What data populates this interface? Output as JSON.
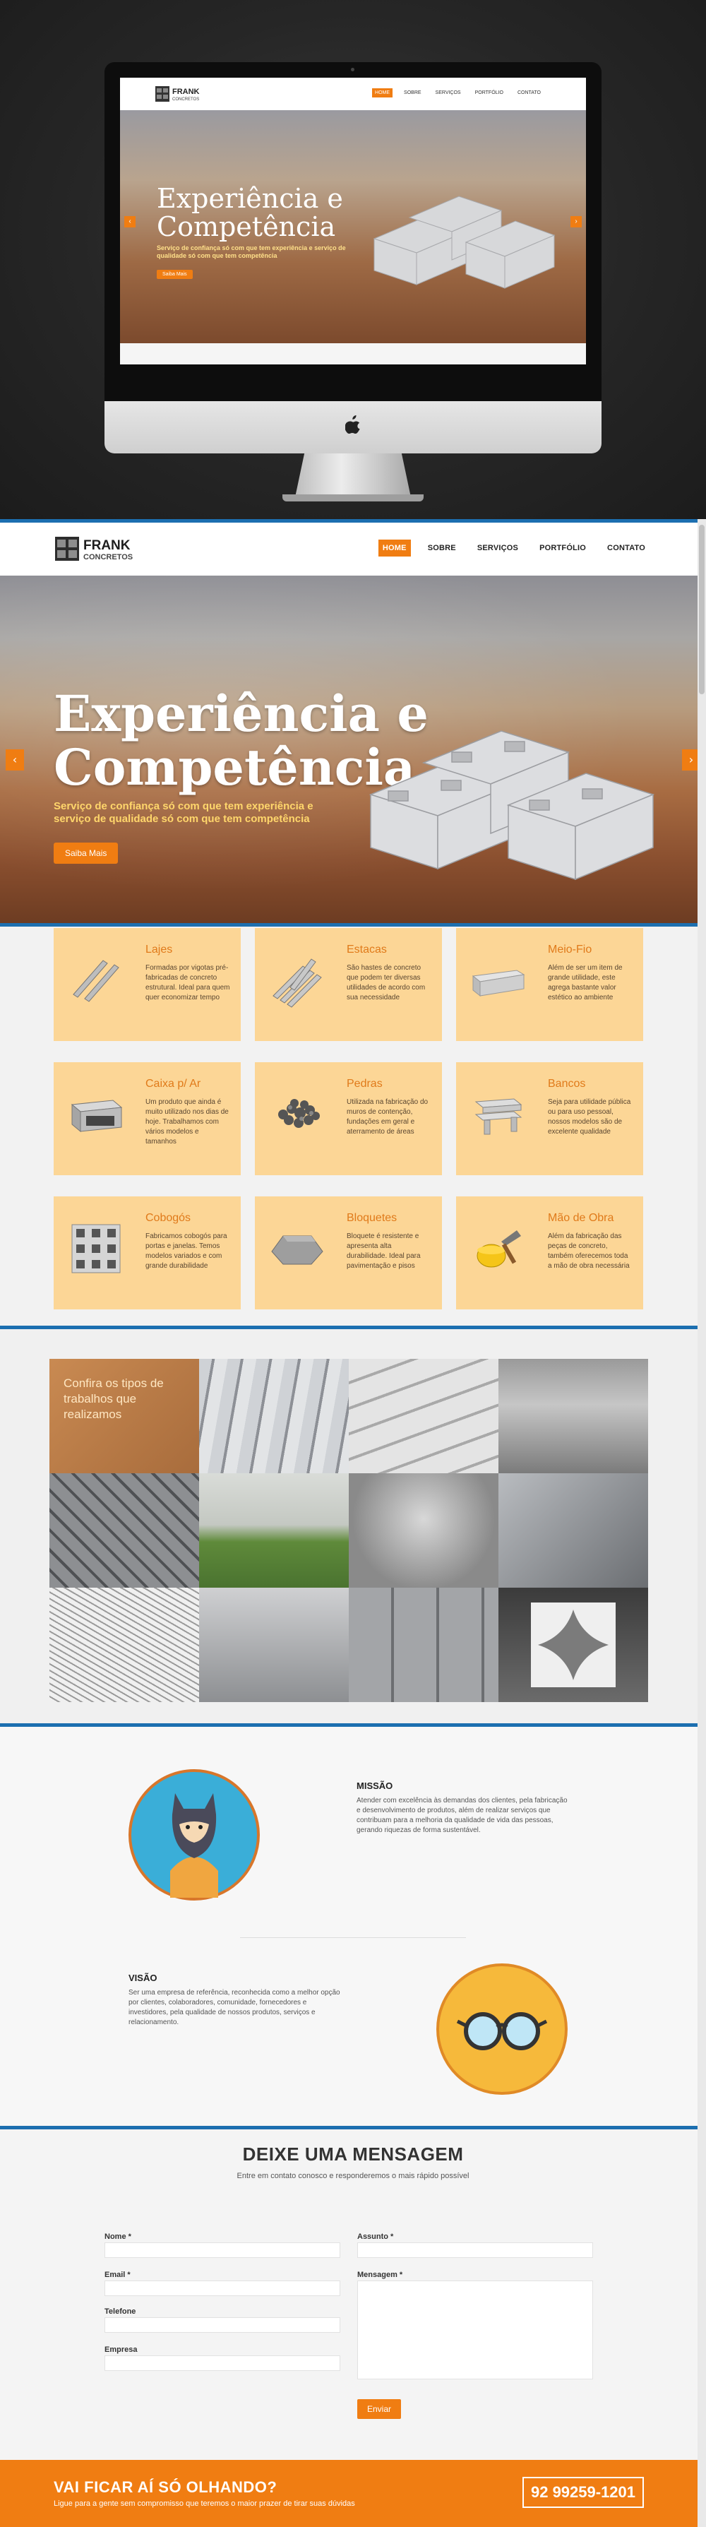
{
  "brand": {
    "name": "FRANK",
    "tagline": "CONCRETOS",
    "accent": "#f07d12",
    "blue": "#1c6fb0"
  },
  "nav": {
    "items": [
      {
        "label": "HOME",
        "active": true
      },
      {
        "label": "SOBRE",
        "active": false
      },
      {
        "label": "SERVIÇOS",
        "active": false
      },
      {
        "label": "PORTFÓLIO",
        "active": false
      },
      {
        "label": "CONTATO",
        "active": false
      }
    ]
  },
  "hero": {
    "title_line1": "Experiência e",
    "title_line2": "Competência",
    "subtitle": "Serviço de confiança só com que tem experiência e serviço de qualidade só com que tem competência",
    "button": "Saiba Mais",
    "prev_icon": "chevron-left-icon",
    "next_icon": "chevron-right-icon"
  },
  "products": [
    {
      "title": "Lajes",
      "desc": "Formadas por vigotas pré-fabricadas de concreto estrutural. Ideal para quem quer economizar tempo",
      "icon": "slab-icon"
    },
    {
      "title": "Estacas",
      "desc": "São hastes de concreto que podem ter diversas utilidades de acordo com sua necessidade",
      "icon": "stakes-icon"
    },
    {
      "title": "Meio-Fio",
      "desc": "Além de ser um item de grande utilidade, este agrega bastante valor estético ao ambiente",
      "icon": "curb-icon"
    },
    {
      "title": "Caixa p/ Ar",
      "desc": "Um produto que ainda é muito utilizado nos dias de hoje. Trabalhamos com vários modelos e tamanhos",
      "icon": "ac-box-icon"
    },
    {
      "title": "Pedras",
      "desc": "Utilizada na fabricação do muros de contenção, fundações em geral e aterramento de áreas",
      "icon": "stones-icon"
    },
    {
      "title": "Bancos",
      "desc": "Seja para utilidade pública ou para uso pessoal, nossos modelos são de excelente qualidade",
      "icon": "bench-icon"
    },
    {
      "title": "Cobogós",
      "desc": "Fabricamos cobogós para portas e janelas. Temos modelos variados e com grande durabilidade",
      "icon": "cobogo-icon"
    },
    {
      "title": "Bloquetes",
      "desc": "Bloquete é resistente e apresenta alta durabilidade. Ideal para pavimentação e pisos",
      "icon": "paver-icon"
    },
    {
      "title": "Mão de Obra",
      "desc": "Além da fabricação das peças de concreto, também oferecemos toda a mão de obra necessária",
      "icon": "workforce-icon"
    }
  ],
  "portfolio": {
    "caption": "Confira os tipos de trabalhos que realizamos",
    "tiles": [
      "tile-1",
      "tile-2",
      "tile-3",
      "tile-4",
      "tile-5",
      "tile-6",
      "tile-7",
      "tile-8",
      "tile-9",
      "tile-10",
      "tile-11",
      "tile-12"
    ]
  },
  "about": {
    "mission_title": "MISSÃO",
    "mission_text": "Atender com excelência às demandas dos clientes, pela fabricação e desenvolvimento de produtos, além de realizar serviços que contribuam para a melhoria da qualidade de vida das pessoas, gerando riquezas de forma sustentável.",
    "vision_title": "VISÃO",
    "vision_text": "Ser uma empresa de referência, reconhecida como a melhor opção por clientes, colaboradores, comunidade, fornecedores e investidores, pela qualidade de nossos produtos, serviços e relacionamento.",
    "mission_icon": "hero-mask-icon",
    "vision_icon": "glasses-icon"
  },
  "contact": {
    "title": "DEIXE UMA MENSAGEM",
    "subtitle": "Entre em contato conosco e responderemos o mais rápido possível",
    "name_label": "Nome *",
    "email_label": "Email *",
    "phone_label": "Telefone",
    "company_label": "Empresa",
    "subject_label": "Assunto *",
    "message_label": "Mensagem *",
    "send": "Enviar"
  },
  "cta": {
    "title": "VAI FICAR AÍ SÓ OLHANDO?",
    "subtitle": "Ligue para a gente sem compromisso que teremos o maior prazer de tirar suas dúvidas",
    "phone": "92 99259-1201"
  },
  "mockup_logo": "apple-logo-icon"
}
